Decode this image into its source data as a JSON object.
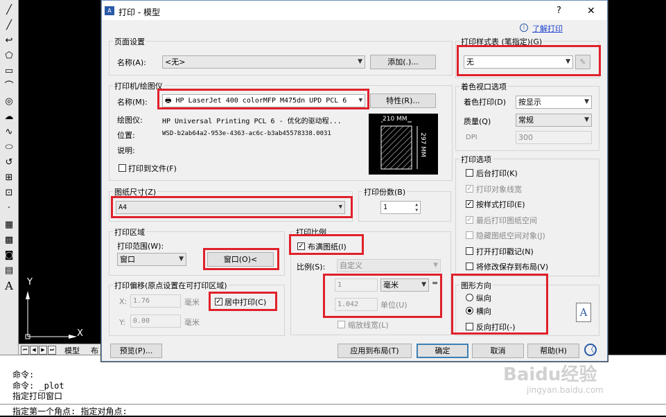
{
  "colors": {
    "highlight": "#e0202a",
    "title_bg": "#ffffff",
    "dialog_bg": "#f0f0f0"
  },
  "cad": {
    "toolbar_icons": [
      "line-icon",
      "polyline-icon",
      "arc-path-icon",
      "pentagon-icon",
      "rectangle-icon",
      "arc-icon",
      "circle-icon",
      "cloud-icon",
      "spline-icon",
      "ellipse-icon",
      "rotate-icon",
      "insert-block-icon",
      "make-block-icon",
      "point-icon",
      "hatch-icon",
      "gradient-icon",
      "region-icon",
      "table-icon",
      "text-icon"
    ],
    "text_tool": "A",
    "ucs": {
      "y": "Y",
      "x": "X"
    },
    "tabs": {
      "model": "模型",
      "layout": "布"
    },
    "command_lines": [
      "命令:",
      "命令: _plot",
      "指定打印窗口",
      "指定第一个角点: 指定对角点:"
    ]
  },
  "dialog": {
    "title": "打印 - 模型",
    "help_btn": "?",
    "close_btn": "✕",
    "learn_link": "了解打印",
    "page_setup": {
      "title": "页面设置",
      "name_label": "名称(A):",
      "name_value": "<无>",
      "add_btn": "添加(.)..."
    },
    "printer": {
      "title": "打印机/绘图仪",
      "name_label": "名称(M):",
      "name_value": "HP LaserJet 400 colorMFP M475dn UPD PCL 6",
      "props_btn": "特性(R)...",
      "plotter_label": "绘图仪:",
      "plotter_value": "HP Universal Printing PCL 6 - 优化的驱动程...",
      "location_label": "位置:",
      "location_value": "WSD-b2ab64a2-953e-4363-ac6c-b3ab45578338.0031",
      "desc_label": "说明:",
      "print_to_file": "打印到文件(F)",
      "preview_width": "210 MM",
      "preview_height": "297 MM"
    },
    "paper": {
      "title": "图纸尺寸(Z)",
      "value": "A4"
    },
    "copies": {
      "title": "打印份数(B)",
      "value": "1"
    },
    "area": {
      "title": "打印区域",
      "range_label": "打印范围(W):",
      "range_value": "窗口",
      "window_btn": "窗口(O)<"
    },
    "offset": {
      "title": "打印偏移(原点设置在可打印区域)",
      "x_label": "X:",
      "x_value": "1.76",
      "y_label": "Y:",
      "y_value": "0.00",
      "unit": "毫米",
      "center": "居中打印(C)"
    },
    "scale": {
      "title": "打印比例",
      "fit": "布满图纸(I)",
      "scale_label": "比例(S):",
      "scale_value": "自定义",
      "value1": "1",
      "unit1": "毫米",
      "eq": "=",
      "value2": "1.042",
      "unit2": "单位(U)",
      "lineweights": "缩放线宽(L)"
    },
    "style_table": {
      "title": "打印样式表 (笔指定)(G)",
      "value": "无"
    },
    "shaded": {
      "title": "着色视口选项",
      "shade_label": "着色打印(D)",
      "shade_value": "按显示",
      "quality_label": "质量(Q)",
      "quality_value": "常规",
      "dpi_label": "DPI",
      "dpi_value": "300"
    },
    "options": {
      "title": "打印选项",
      "items": [
        {
          "label": "后台打印(K)",
          "checked": "",
          "disabled": false
        },
        {
          "label": "打印对象线宽",
          "checked": "✓",
          "disabled": true
        },
        {
          "label": "按样式打印(E)",
          "checked": "✓",
          "disabled": false
        },
        {
          "label": "最后打印图纸空间",
          "checked": "✓",
          "disabled": true
        },
        {
          "label": "隐藏图纸空间对象(J)",
          "checked": "",
          "disabled": true
        },
        {
          "label": "打开打印戳记(N)",
          "checked": "",
          "disabled": false
        },
        {
          "label": "将修改保存到布局(V)",
          "checked": "",
          "disabled": false
        }
      ]
    },
    "orientation": {
      "title": "图形方向",
      "portrait": "纵向",
      "landscape": "横向",
      "reverse": "反向打印(-)",
      "icon_letter": "A"
    },
    "footer": {
      "preview": "预览(P)...",
      "apply": "应用到布局(T)",
      "ok": "确定",
      "cancel": "取消",
      "help": "帮助(H)",
      "more": "〈"
    }
  },
  "watermark": {
    "brand": "Baidu经验",
    "url": "jingyan.baidu.com"
  }
}
